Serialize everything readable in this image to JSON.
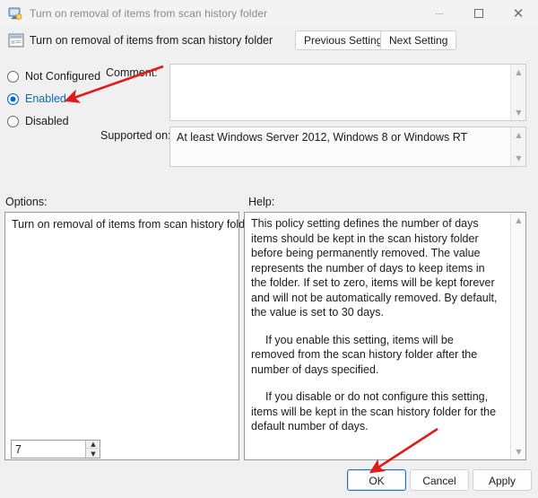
{
  "window": {
    "title": "Turn on removal of items from scan history folder",
    "title_icon": "monitor-policy-icon",
    "controls": {
      "minimize": "—",
      "maximize": "□",
      "close": "×"
    }
  },
  "header": {
    "icon": "monitor-policy-icon",
    "title": "Turn on removal of items from scan history folder",
    "previous_setting": "Previous Setting",
    "next_setting": "Next Setting"
  },
  "state_options": {
    "items": [
      {
        "label": "Not Configured",
        "selected": false
      },
      {
        "label": "Enabled",
        "selected": true
      },
      {
        "label": "Disabled",
        "selected": false
      }
    ]
  },
  "comment": {
    "label": "Comment:",
    "value": "",
    "scroll_up": "▲",
    "scroll_down": "▼"
  },
  "supported_on": {
    "label": "Supported on:",
    "value": "At least Windows Server 2012, Windows 8 or Windows RT",
    "scroll_up": "▲",
    "scroll_down": "▼"
  },
  "options": {
    "label": "Options:",
    "setting_label": "Turn on removal of items from scan history folder",
    "spinner_value": "7",
    "spinner_up": "▲",
    "spinner_down": "▼"
  },
  "help": {
    "label": "Help:",
    "paragraphs": [
      "This policy setting defines the number of days items should be kept in the scan history folder before being permanently removed. The value represents the number of days to keep items in the folder. If set to zero, items will be kept forever and will not be automatically removed. By default, the value is set to 30 days.",
      "If you enable this setting, items will be removed from the scan history folder after the number of days specified.",
      "If you disable or do not configure this setting, items will be kept in the scan history folder for the default number of days."
    ],
    "scroll_up": "▲",
    "scroll_down": "▼"
  },
  "footer": {
    "ok": "OK",
    "cancel": "Cancel",
    "apply": "Apply"
  },
  "annotations": {
    "color": "#e01b1b",
    "arrow_1_target": "Enabled",
    "arrow_2_target": "OK"
  }
}
